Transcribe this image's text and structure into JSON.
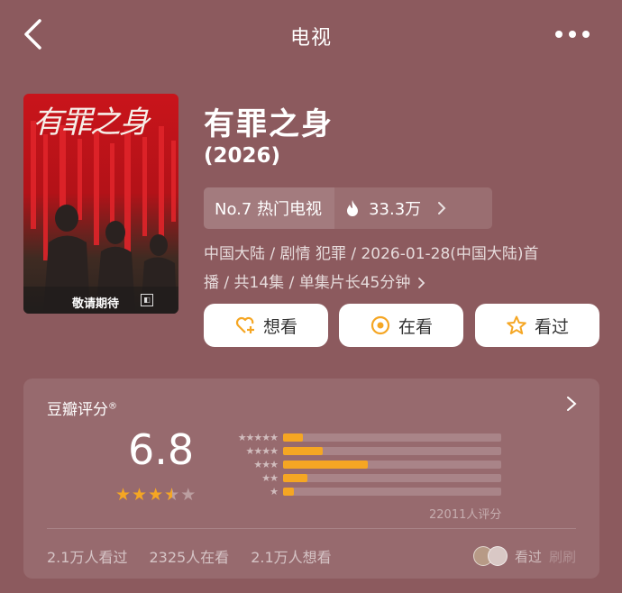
{
  "header": {
    "title": "电视",
    "back_icon": "chevron-left-icon",
    "more_icon": "more-dots-icon"
  },
  "poster": {
    "title_art": "有罪之身",
    "badge": "敬请期待"
  },
  "show": {
    "name": "有罪之身",
    "year": "(2026)"
  },
  "rank": {
    "label": "No.7 热门电视",
    "heat": "33.3万",
    "heat_icon": "flame-icon"
  },
  "meta": {
    "line1": "中国大陆 / 剧情 犯罪 / 2026-01-28(中国大陆)首",
    "line2": "播 / 共14集 / 单集片长45分钟"
  },
  "actions": {
    "want_label": "想看",
    "watching_label": "在看",
    "watched_label": "看过",
    "icon_color": "#f5a623"
  },
  "rating": {
    "title": "豆瓣评分",
    "title_mark": "®",
    "score": "6.8",
    "stars_value": 3.5,
    "votes": "22011人评分",
    "distribution": [
      {
        "stars": "★★★★★",
        "fraction": 0.09
      },
      {
        "stars": "★★★★",
        "fraction": 0.18
      },
      {
        "stars": "★★★",
        "fraction": 0.39
      },
      {
        "stars": "★★",
        "fraction": 0.11
      },
      {
        "stars": "★",
        "fraction": 0.05
      }
    ],
    "accent": "#f5a623"
  },
  "stats": {
    "watched": "2.1万人看过",
    "watching": "2325人在看",
    "want": "2.1万人想看"
  },
  "friends": {
    "label": "看过",
    "label2": "刷刷"
  }
}
